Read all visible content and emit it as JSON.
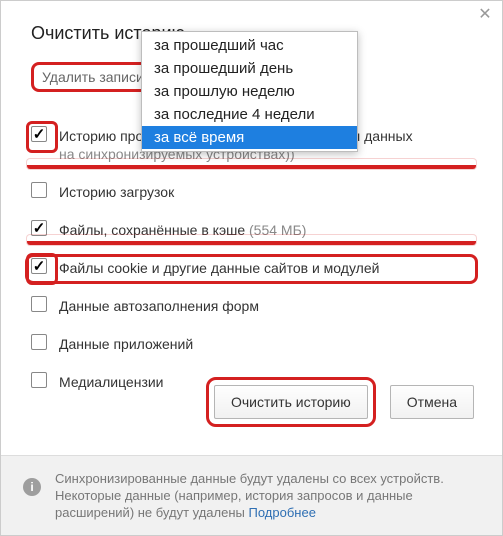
{
  "dialog": {
    "title": "Очистить историю",
    "delete_label": "Удалить записи:"
  },
  "dropdown": {
    "items": [
      "за прошедший час",
      "за прошедший день",
      "за прошлую неделю",
      "за последние 4 недели",
      "за всё время"
    ],
    "selected_index": 4
  },
  "options": [
    {
      "checked": true,
      "highlight": "underline",
      "cb_highlight": true,
      "text": "Историю просмотров (5 242 записи (не считая данных",
      "sub": "на синхронизируемых устройствах))"
    },
    {
      "checked": false,
      "text": "Историю загрузок"
    },
    {
      "checked": true,
      "highlight": "underline",
      "text": "Файлы, сохранённые в кэше",
      "muted": "(554 МБ)"
    },
    {
      "checked": true,
      "highlight": "outline",
      "cb_highlight": true,
      "text": "Файлы cookie и другие данные сайтов и модулей"
    },
    {
      "checked": false,
      "text": "Данные автозаполнения форм"
    },
    {
      "checked": false,
      "text": "Данные приложений"
    },
    {
      "checked": false,
      "text": "Медиалицензии",
      "cut": true
    }
  ],
  "buttons": {
    "clear": "Очистить историю",
    "cancel": "Отмена"
  },
  "footer": {
    "line1": "Синхронизированные данные будут удалены со всех устройств.",
    "line2": "Некоторые данные (например, история запросов и данные",
    "line3_prefix": "расширений) не будут удалены ",
    "link": "Подробнее"
  }
}
